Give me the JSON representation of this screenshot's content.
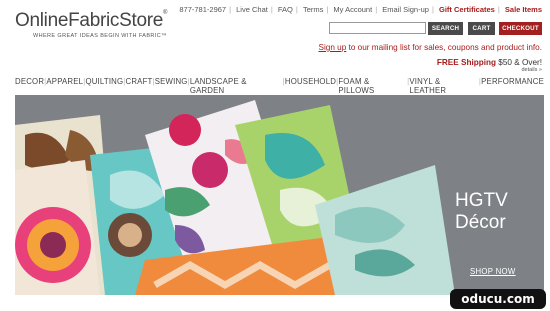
{
  "logo": {
    "name": "OnlineFabricStore",
    "trademark": "®",
    "tagline": "WHERE GREAT IDEAS BEGIN WITH FABRIC™"
  },
  "toplinks": {
    "phone": "877-781-2967",
    "live_chat": "Live Chat",
    "faq": "FAQ",
    "terms": "Terms",
    "account": "My Account",
    "email_signup": "Email Sign-up",
    "gift": "Gift Certificates",
    "sale": "Sale Items"
  },
  "search": {
    "value": "",
    "button": "SEARCH"
  },
  "cart_label": "CART",
  "checkout_label": "CHECKOUT",
  "signup": {
    "link": "Sign up",
    "rest": " to our mailing list for sales, coupons and product info."
  },
  "shipping": {
    "label": "FREE Shipping",
    "rest": " $50 & Over!",
    "details": "details »"
  },
  "nav": [
    "DECOR",
    "APPAREL",
    "QUILTING",
    "CRAFT",
    "SEWING",
    "LANDSCAPE & GARDEN",
    "HOUSEHOLD",
    "FOAM & PILLOWS",
    "VINYL & LEATHER",
    "PERFORMANCE"
  ],
  "hero": {
    "title_line1": "HGTV",
    "title_line2": "Décor",
    "cta": "SHOP NOW"
  },
  "watermark": "oducu.com",
  "colors": {
    "accent_red": "#a81c1c",
    "dark_button": "#4a4a4a",
    "hero_bg": "#7e8186"
  }
}
